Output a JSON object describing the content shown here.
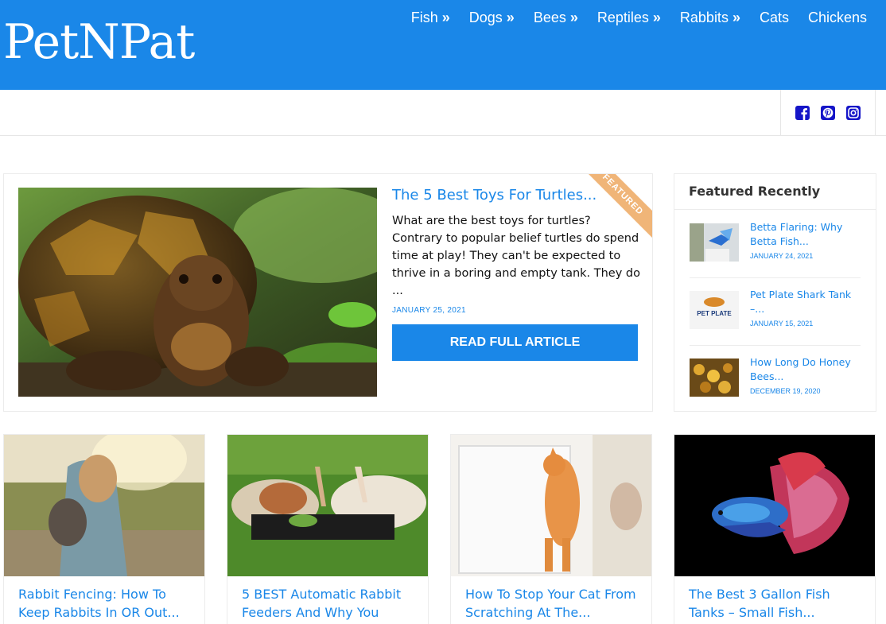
{
  "header": {
    "logo": "PetNPat",
    "nav": [
      {
        "label": "Fish",
        "has_submenu": true
      },
      {
        "label": "Dogs",
        "has_submenu": true
      },
      {
        "label": "Bees",
        "has_submenu": true
      },
      {
        "label": "Reptiles",
        "has_submenu": true
      },
      {
        "label": "Rabbits",
        "has_submenu": true
      },
      {
        "label": "Cats",
        "has_submenu": false
      },
      {
        "label": "Chickens",
        "has_submenu": false
      }
    ],
    "submenu_glyph": "»"
  },
  "social": [
    "facebook-icon",
    "pinterest-icon",
    "instagram-icon"
  ],
  "featured": {
    "title": "The 5 Best Toys For Turtles...",
    "excerpt": "What are the best toys for turtles? Contrary to popular belief turtles do spend time at play!   They can't be expected to thrive in a boring and empty tank. They do ...",
    "date": "JANUARY 25, 2021",
    "button": "READ FULL ARTICLE",
    "ribbon": "FEATURED"
  },
  "sidebar": {
    "title": "Featured Recently",
    "items": [
      {
        "title": "Betta Flaring: Why Betta Fish...",
        "date": "JANUARY 24, 2021"
      },
      {
        "title": "Pet Plate Shark Tank –...",
        "date": "JANUARY 15, 2021",
        "thumb_text": "PET PLATE"
      },
      {
        "title": "How Long Do Honey Bees...",
        "date": "DECEMBER 19, 2020"
      }
    ]
  },
  "cards": [
    {
      "title": "Rabbit Fencing: How To Keep Rabbits In OR Out..."
    },
    {
      "title": "5 BEST Automatic Rabbit Feeders And Why You"
    },
    {
      "title": "How To Stop Your Cat From Scratching At The..."
    },
    {
      "title": "The Best 3 Gallon Fish Tanks – Small Fish..."
    }
  ],
  "colors": {
    "brand": "#1a87e8",
    "ribbon": "#f0b578",
    "social": "#1515c8"
  }
}
